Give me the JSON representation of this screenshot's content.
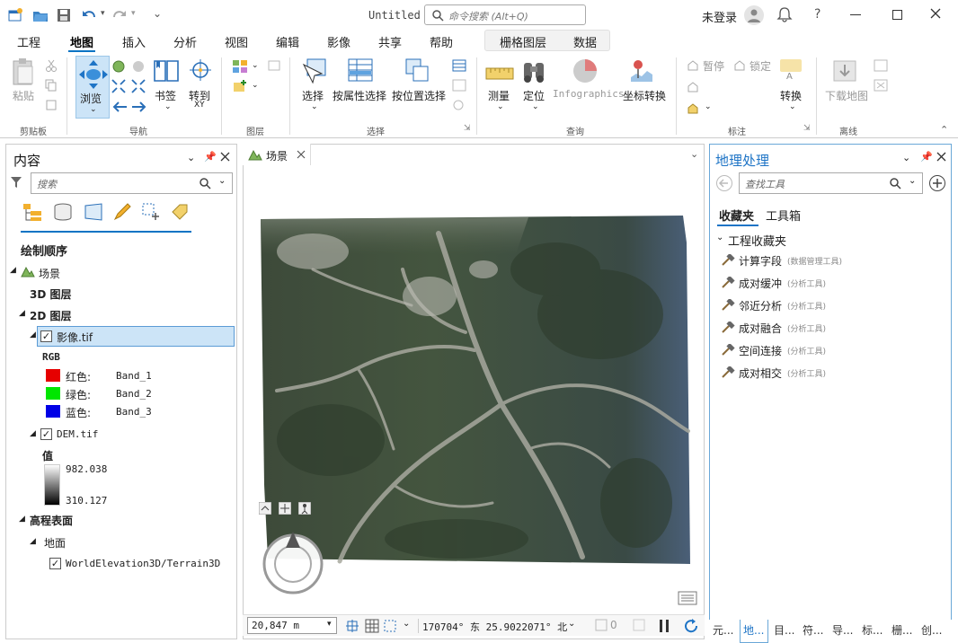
{
  "app": {
    "title": "Untitled",
    "search_placeholder": "命令搜索 (Alt+Q)",
    "user": "未登录",
    "help": "?",
    "accent": "#0b74c4"
  },
  "menu": {
    "items": [
      "工程",
      "地图",
      "插入",
      "分析",
      "视图",
      "编辑",
      "影像",
      "共享",
      "帮助"
    ],
    "active": "地图",
    "context": [
      "栅格图层",
      "数据"
    ]
  },
  "ribbon": {
    "paste": "粘贴",
    "browse": "浏览",
    "bookmark": "书签",
    "goto": "转到",
    "goto_xy": "XY",
    "select": "选择",
    "select_attr": "按属性选择",
    "select_loc": "按位置选择",
    "measure": "测量",
    "locate": "定位",
    "infographics": "Infographics",
    "coord_convert": "坐标转换",
    "pause": "暂停",
    "lock": "锁定",
    "convert": "转换",
    "download_map": "下载地图",
    "groups": {
      "clipboard": "剪贴板",
      "navigate": "导航",
      "layer": "图层",
      "selection": "选择",
      "inquiry": "查询",
      "labeling": "标注",
      "offline": "离线"
    }
  },
  "contents": {
    "title": "内容",
    "search_placeholder": "搜索",
    "draw_order": "绘制顺序",
    "scene": "场景",
    "layers3d": "3D 图层",
    "layers2d": "2D 图层",
    "image_layer": "影像.tif",
    "rgb": "RGB",
    "bands": [
      {
        "label": "红色:",
        "band": "Band_1",
        "color": "#e60000"
      },
      {
        "label": "绿色:",
        "band": "Band_2",
        "color": "#00e600"
      },
      {
        "label": "蓝色:",
        "band": "Band_3",
        "color": "#0000e6"
      }
    ],
    "dem_layer": "DEM.tif",
    "value_label": "值",
    "value_max": "982.038",
    "value_min": "310.127",
    "elevation": "高程表面",
    "ground": "地面",
    "terrain": "WorldElevation3D/Terrain3D"
  },
  "scene": {
    "tab": "场景",
    "scale": "20,847 m",
    "coords": "170704° 东  25.9022071° 北",
    "selected_count": "0"
  },
  "geoprocessing": {
    "title": "地理处理",
    "search_placeholder": "查找工具",
    "tabs": [
      "收藏夹",
      "工具箱"
    ],
    "group": "工程收藏夹",
    "tools": [
      {
        "name": "计算字段",
        "box": "(数据管理工具)"
      },
      {
        "name": "成对缓冲",
        "box": "(分析工具)"
      },
      {
        "name": "邻近分析",
        "box": "(分析工具)"
      },
      {
        "name": "成对融合",
        "box": "(分析工具)"
      },
      {
        "name": "空间连接",
        "box": "(分析工具)"
      },
      {
        "name": "成对相交",
        "box": "(分析工具)"
      }
    ]
  },
  "bottom_tabs": [
    "元...",
    "地...",
    "目...",
    "符...",
    "导...",
    "标...",
    "栅...",
    "创..."
  ]
}
